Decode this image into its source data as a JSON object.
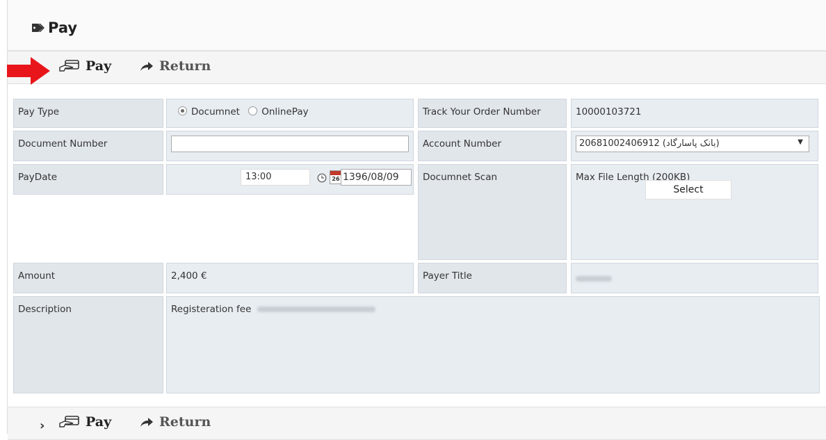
{
  "page": {
    "title": "Pay"
  },
  "toolbar": {
    "pay_label": "Pay",
    "return_label": "Return"
  },
  "form": {
    "pay_type": {
      "label": "Pay Type",
      "options": [
        "Documnet",
        "OnlinePay"
      ],
      "selected": "Documnet"
    },
    "track_order": {
      "label": "Track Your Order Number",
      "value": "10000103721"
    },
    "document_number": {
      "label": "Document Number",
      "value": ""
    },
    "account_number": {
      "label": "Account Number",
      "value": "20681002406912 (بانک پاسارگاد)"
    },
    "pay_date": {
      "label": "PayDate",
      "time": "13:00",
      "date": "1396/08/09",
      "calendar_day": "26"
    },
    "document_scan": {
      "label": "Documnet Scan",
      "hint": "Max File Length (200KB)",
      "button": "Select"
    },
    "amount": {
      "label": "Amount",
      "value": "2,400 €"
    },
    "payer_title": {
      "label": "Payer Title"
    },
    "description": {
      "label": "Description",
      "value": "Registeration fee"
    }
  },
  "colors": {
    "indicator_arrow": "#e8161b",
    "label_bg": "#e1e6eb",
    "field_bg": "#e8edf2"
  }
}
